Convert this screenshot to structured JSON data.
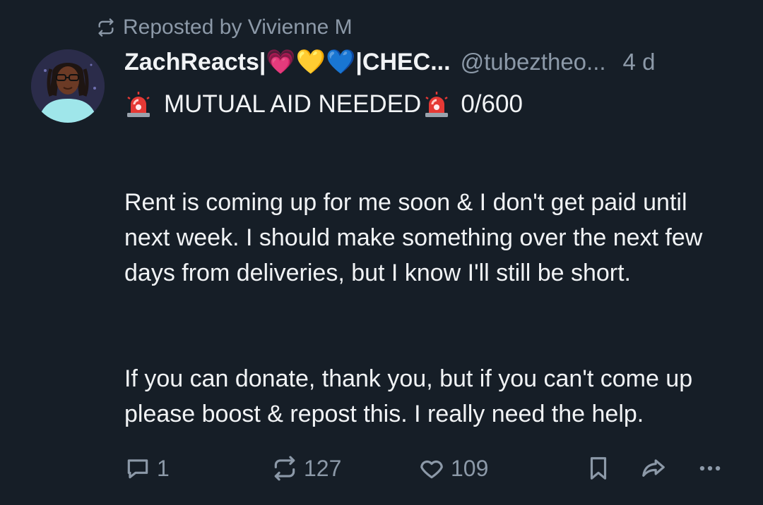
{
  "repost": {
    "label": "Reposted by Vivienne M"
  },
  "author": {
    "display_name": "ZachReacts|💗💛💙|CHEC...",
    "handle": "@tubeztheo...",
    "timestamp": "4 d",
    "avatar_icon": "avatar-illustration"
  },
  "post": {
    "title": "MUTUAL AID NEEDED",
    "progress": "0/600",
    "title_icon": "siren-icon",
    "paragraph1": "Rent is coming up for me soon & I don't get paid until next week. I should make something over the next few days from deliveries, but I know I'll still be short.",
    "paragraph2": "If you can donate, thank you, but if you can't come up please boost & repost this. I really need the help."
  },
  "actions": {
    "reply_count": "1",
    "repost_count": "127",
    "like_count": "109",
    "reply_icon": "reply-icon",
    "repost_icon": "repost-icon",
    "like_icon": "heart-icon",
    "bookmark_icon": "bookmark-icon",
    "share_icon": "share-icon",
    "more_icon": "more-icon"
  },
  "colors": {
    "background": "#161e27",
    "text": "#f1f3f5",
    "muted": "#8c99a8",
    "siren_red": "#e53935"
  }
}
